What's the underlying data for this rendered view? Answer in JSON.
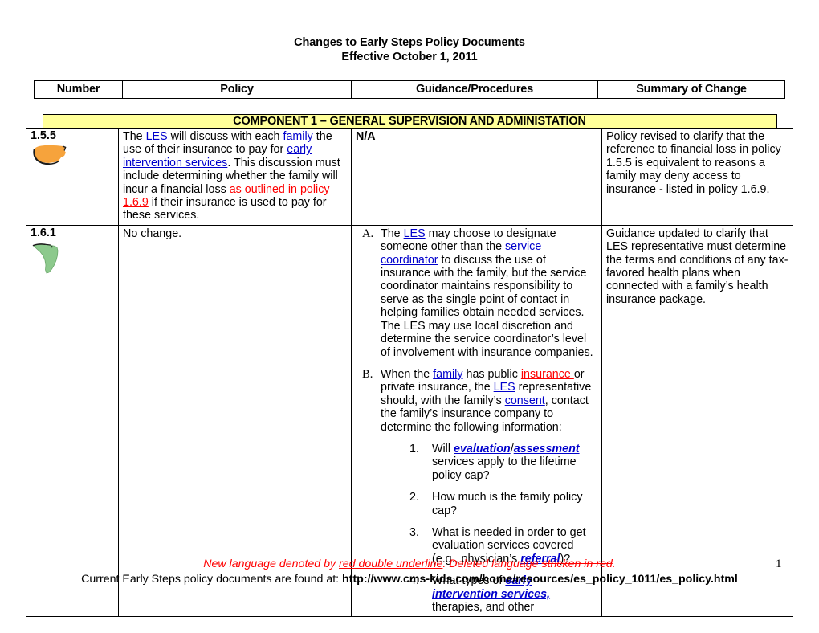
{
  "document": {
    "title": "Changes to Early Steps Policy Documents",
    "subtitle": "Effective October 1, 2011",
    "page_number": "1"
  },
  "table": {
    "columns": [
      {
        "key": "number",
        "label": "Number"
      },
      {
        "key": "policy",
        "label": "Policy"
      },
      {
        "key": "guidance",
        "label": "Guidance/Procedures"
      },
      {
        "key": "summary",
        "label": "Summary of Change"
      }
    ],
    "banner": "COMPONENT 1 – GENERAL SUPERVISION AND ADMINISTATION",
    "rows": [
      {
        "number": "1.5.5",
        "icon": "us-map-icon",
        "icon_color": "#F6A33C",
        "policy": {
          "segments": [
            {
              "text": "The ",
              "style": "plain"
            },
            {
              "text": "LES",
              "style": "link"
            },
            {
              "text": " will discuss with each ",
              "style": "plain"
            },
            {
              "text": "family",
              "style": "link"
            },
            {
              "text": " the use of their insurance to pay for ",
              "style": "plain"
            },
            {
              "text": "early intervention services",
              "style": "link"
            },
            {
              "text": ".  This discussion must include determining whether the family will incur a financial loss ",
              "style": "plain"
            },
            {
              "text": "as outlined in policy 1.6.9",
              "style": "new"
            },
            {
              "text": " if their insurance is used to pay for these services.",
              "style": "plain"
            }
          ]
        },
        "guidance": {
          "text": "N/A",
          "style": "bold"
        },
        "summary": "Policy revised to clarify that the reference to financial loss in policy 1.5.5 is equivalent to reasons a family may deny access to insurance - listed in policy 1.6.9."
      },
      {
        "number": "1.6.1",
        "icon": "florida-map-icon",
        "icon_color": "#8CC98C",
        "policy": {
          "text": "No change."
        },
        "guidance_list": [
          {
            "marker": "A.",
            "segments": [
              {
                "text": "The ",
                "style": "plain"
              },
              {
                "text": "LES",
                "style": "link"
              },
              {
                "text": " may choose to designate someone other than the ",
                "style": "plain"
              },
              {
                "text": "service coordinator",
                "style": "link"
              },
              {
                "text": " to discuss the use of insurance with the family, but the service coordinator maintains responsibility to serve as the single point of contact in helping families obtain needed services. The LES may use local discretion and determine the service coordinator’s level of involvement with insurance companies.",
                "style": "plain"
              }
            ]
          },
          {
            "marker": "B.",
            "segments": [
              {
                "text": "When the ",
                "style": "plain"
              },
              {
                "text": "family",
                "style": "link"
              },
              {
                "text": " has public ",
                "style": "plain"
              },
              {
                "text": "insurance ",
                "style": "new"
              },
              {
                "text": "or private insurance, the ",
                "style": "plain"
              },
              {
                "text": "LES",
                "style": "link"
              },
              {
                "text": " representative should, with the family’s ",
                "style": "plain"
              },
              {
                "text": "consent",
                "style": "link"
              },
              {
                "text": ", contact the family’s insurance company to determine the following information:",
                "style": "plain"
              }
            ],
            "sub_items": [
              {
                "marker": "1.",
                "segments": [
                  {
                    "text": "Will ",
                    "style": "plain"
                  },
                  {
                    "text": "evaluation",
                    "style": "link-bold-italic"
                  },
                  {
                    "text": "/",
                    "style": "plain"
                  },
                  {
                    "text": "assessment",
                    "style": "link-bold-italic"
                  },
                  {
                    "text": " services apply to the lifetime policy cap?",
                    "style": "plain"
                  }
                ]
              },
              {
                "marker": "2.",
                "segments": [
                  {
                    "text": "How much is the family policy cap?",
                    "style": "plain"
                  }
                ]
              },
              {
                "marker": "3.",
                "segments": [
                  {
                    "text": "What is needed in order to get evaluation services covered (e.g., physician’s ",
                    "style": "plain"
                  },
                  {
                    "text": "referral",
                    "style": "link-bold-italic"
                  },
                  {
                    "text": ")?",
                    "style": "plain"
                  }
                ]
              },
              {
                "marker": "4.",
                "segments": [
                  {
                    "text": "What types of ",
                    "style": "plain"
                  },
                  {
                    "text": "early intervention services,",
                    "style": "link-bold-italic"
                  },
                  {
                    "text": " therapies, and other",
                    "style": "plain"
                  }
                ]
              }
            ]
          }
        ],
        "summary": "Guidance updated to clarify that LES representative must determine the terms and conditions of any tax-favored health plans when connected with a family’s health insurance package."
      }
    ]
  },
  "footer": {
    "legend": {
      "part1": "New language denoted by ",
      "new_sample": "red double underline",
      "part2": ".  Deleted language ",
      "deleted_sample": "stricken in red",
      "part3": "."
    },
    "url_line": {
      "prefix": "Current Early Steps policy documents are found at: ",
      "url": "http://www.cms-kids.com/home/resources/es_policy_1011/es_policy.html"
    }
  },
  "colors": {
    "banner_background": "#FFFF99",
    "link": "#0000CC",
    "new_language": "#FF0000",
    "deleted_language": "#FF0000",
    "border": "#000000"
  }
}
